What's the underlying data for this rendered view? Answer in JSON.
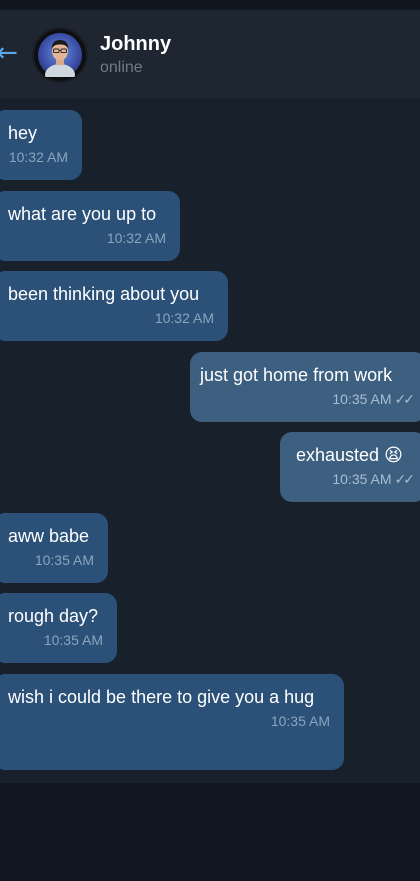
{
  "header": {
    "back_icon": "back-arrow-icon",
    "contact_name": "Johnny",
    "contact_status": "online"
  },
  "colors": {
    "background": "#121923",
    "header": "#1d2631",
    "incoming_bubble": "#2b5178",
    "outgoing_bubble": "#3d5f80",
    "accent": "#5fa7e4"
  },
  "messages": [
    {
      "direction": "in",
      "text": "hey",
      "time": "10:32 AM"
    },
    {
      "direction": "in",
      "text": "what are you up to",
      "time": "10:32 AM"
    },
    {
      "direction": "in",
      "text": "been thinking about you",
      "time": "10:32 AM"
    },
    {
      "direction": "out",
      "text": "just got home from work",
      "time": "10:35 AM",
      "ticks": "✓✓"
    },
    {
      "direction": "out",
      "text": "exhausted 😫",
      "time": "10:35 AM",
      "ticks": "✓✓"
    },
    {
      "direction": "in",
      "text": "aww babe",
      "time": "10:35 AM"
    },
    {
      "direction": "in",
      "text": "rough day?",
      "time": "10:35 AM"
    },
    {
      "direction": "in",
      "text": "wish i could be there to give you a hug",
      "time": "10:35 AM"
    }
  ]
}
